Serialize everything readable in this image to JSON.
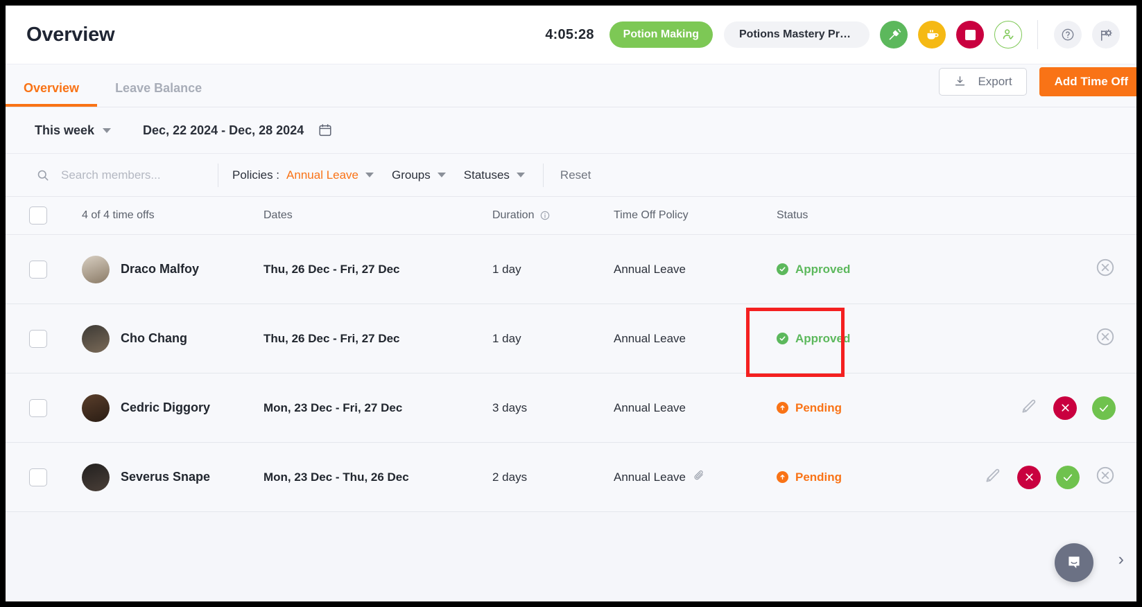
{
  "header": {
    "title": "Overview",
    "timer": "4:05:28",
    "task_pill": "Potion Making",
    "project_pill": "Potions Mastery Progr...",
    "icons": {
      "tracker": "tracker-icon",
      "break": "coffee-cup-icon",
      "stop": "stop-icon",
      "attendance": "user-check-icon",
      "help": "question-mark-icon",
      "settings": "flag-gear-icon"
    }
  },
  "tabs": [
    {
      "label": "Overview",
      "active": true
    },
    {
      "label": "Leave Balance",
      "active": false
    }
  ],
  "toolbar": {
    "export_label": "Export",
    "add_time_off_label": "Add Time Off"
  },
  "datefilter": {
    "period": "This week",
    "range": "Dec, 22 2024 - Dec, 28 2024"
  },
  "filters": {
    "search_placeholder": "Search members...",
    "search_value": "",
    "policies_label": "Policies :",
    "policies_value": "Annual Leave",
    "groups_label": "Groups",
    "statuses_label": "Statuses",
    "reset_label": "Reset"
  },
  "table": {
    "columns": {
      "count": "4 of 4 time offs",
      "dates": "Dates",
      "duration": "Duration",
      "policy": "Time Off Policy",
      "status": "Status"
    },
    "rows": [
      {
        "name": "Draco Malfoy",
        "dates": "Thu, 26 Dec - Fri, 27 Dec",
        "duration": "1 day",
        "policy": "Annual Leave",
        "has_attachment": false,
        "status": "Approved",
        "status_type": "approved",
        "actions": [
          "cancel-outline-icon"
        ]
      },
      {
        "name": "Cho Chang",
        "dates": "Thu, 26 Dec - Fri, 27 Dec",
        "duration": "1 day",
        "policy": "Annual Leave",
        "has_attachment": false,
        "status": "Approved",
        "status_type": "approved",
        "actions": [
          "cancel-outline-icon"
        ]
      },
      {
        "name": "Cedric Diggory",
        "dates": "Mon, 23 Dec - Fri, 27 Dec",
        "duration": "3 days",
        "policy": "Annual Leave",
        "has_attachment": false,
        "status": "Pending",
        "status_type": "pending",
        "actions": [
          "edit-pencil-icon",
          "reject-icon",
          "approve-icon"
        ]
      },
      {
        "name": "Severus Snape",
        "dates": "Mon, 23 Dec - Thu, 26 Dec",
        "duration": "2 days",
        "policy": "Annual Leave",
        "has_attachment": true,
        "status": "Pending",
        "status_type": "pending",
        "actions": [
          "edit-pencil-icon",
          "reject-icon",
          "approve-icon",
          "cancel-outline-icon"
        ]
      }
    ]
  },
  "annotation": {
    "highlight_color": "#f42020",
    "target": "Approved status of Cho Chang row"
  },
  "colors": {
    "accent_orange": "#f97316",
    "green": "#5cb85c",
    "crimson": "#c9003f",
    "yellow": "#f5b914"
  }
}
